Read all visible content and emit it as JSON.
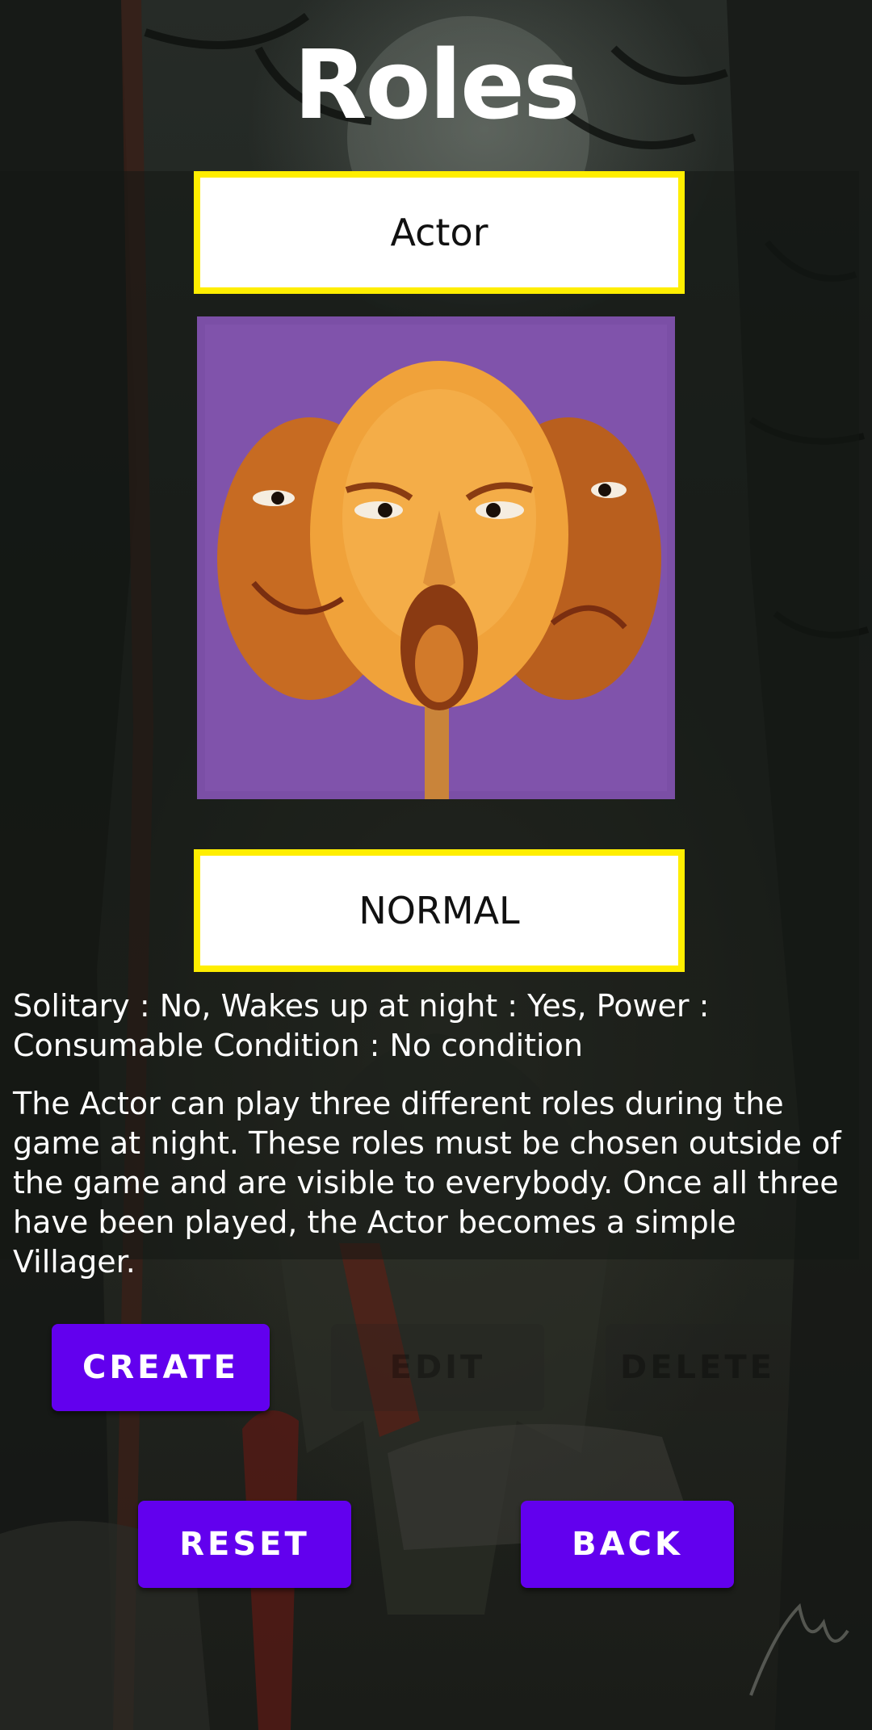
{
  "screen": {
    "title": "Roles"
  },
  "role": {
    "name": "Actor",
    "image_icon": "three-faced-actor-mask",
    "type": "NORMAL",
    "stats": "Solitary : No, Wakes up at night : Yes, Power : Consumable Condition : No condition",
    "description": "The Actor can play three different roles during the game at night. These roles must be chosen outside of the game and are visible to everybody. Once all three have been played, the Actor becomes a simple Villager."
  },
  "actions": {
    "create_label": "CREATE",
    "edit_label": "EDIT",
    "delete_label": "DELETE",
    "reset_label": "RESET",
    "back_label": "BACK"
  },
  "colors": {
    "accent": "#6200ee",
    "highlight_border": "#ffee00",
    "text": "#ffffff"
  }
}
